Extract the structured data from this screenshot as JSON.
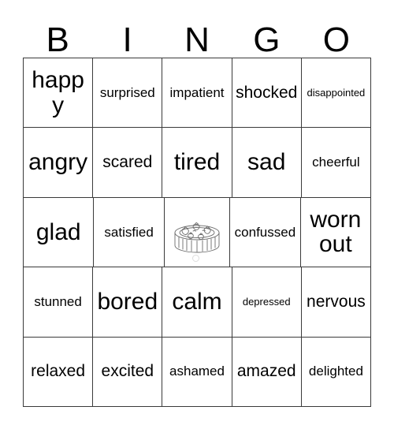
{
  "card": {
    "header_letters": [
      "B",
      "I",
      "N",
      "G",
      "O"
    ],
    "rows": [
      [
        {
          "text": "happy",
          "size": "fs-xl"
        },
        {
          "text": "surprised",
          "size": "fs-sm"
        },
        {
          "text": "impatient",
          "size": "fs-sm"
        },
        {
          "text": "shocked",
          "size": "fs-md"
        },
        {
          "text": "disappointed",
          "size": "fs-xs"
        }
      ],
      [
        {
          "text": "angry",
          "size": "fs-xl"
        },
        {
          "text": "scared",
          "size": "fs-md"
        },
        {
          "text": "tired",
          "size": "fs-xl"
        },
        {
          "text": "sad",
          "size": "fs-xl"
        },
        {
          "text": "cheerful",
          "size": "fs-sm"
        }
      ],
      [
        {
          "text": "glad",
          "size": "fs-xl"
        },
        {
          "text": "satisfied",
          "size": "fs-sm"
        },
        {
          "text": "",
          "size": "free",
          "free_space": true,
          "image": "strawberry-cake-illustration"
        },
        {
          "text": "confussed",
          "size": "fs-sm"
        },
        {
          "text": "worn out",
          "size": "fs-xl"
        }
      ],
      [
        {
          "text": "stunned",
          "size": "fs-sm"
        },
        {
          "text": "bored",
          "size": "fs-xl"
        },
        {
          "text": "calm",
          "size": "fs-xl"
        },
        {
          "text": "depressed",
          "size": "fs-xs"
        },
        {
          "text": "nervous",
          "size": "fs-md"
        }
      ],
      [
        {
          "text": "relaxed",
          "size": "fs-md"
        },
        {
          "text": "excited",
          "size": "fs-md"
        },
        {
          "text": "ashamed",
          "size": "fs-sm"
        },
        {
          "text": "amazed",
          "size": "fs-md"
        },
        {
          "text": "delighted",
          "size": "fs-sm"
        }
      ]
    ],
    "watermark": {
      "text": "",
      "legible": false
    },
    "colors": {
      "text": "#000000",
      "grid_line": "#3a3a3a",
      "background": "#ffffff",
      "illustration": "#6b6b6b",
      "watermark": "#9a9a9a"
    }
  }
}
